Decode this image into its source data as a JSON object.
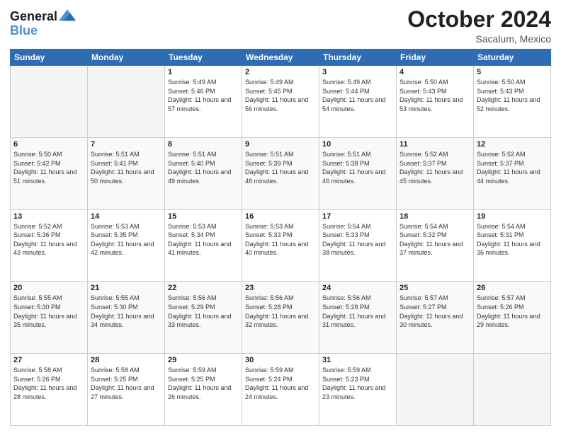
{
  "header": {
    "logo_line1": "General",
    "logo_line2": "Blue",
    "month": "October 2024",
    "location": "Sacalum, Mexico"
  },
  "weekdays": [
    "Sunday",
    "Monday",
    "Tuesday",
    "Wednesday",
    "Thursday",
    "Friday",
    "Saturday"
  ],
  "weeks": [
    [
      {
        "day": "",
        "empty": true
      },
      {
        "day": "",
        "empty": true
      },
      {
        "day": "1",
        "sunrise": "5:49 AM",
        "sunset": "5:46 PM",
        "daylight": "11 hours and 57 minutes."
      },
      {
        "day": "2",
        "sunrise": "5:49 AM",
        "sunset": "5:45 PM",
        "daylight": "11 hours and 56 minutes."
      },
      {
        "day": "3",
        "sunrise": "5:49 AM",
        "sunset": "5:44 PM",
        "daylight": "11 hours and 54 minutes."
      },
      {
        "day": "4",
        "sunrise": "5:50 AM",
        "sunset": "5:43 PM",
        "daylight": "11 hours and 53 minutes."
      },
      {
        "day": "5",
        "sunrise": "5:50 AM",
        "sunset": "5:43 PM",
        "daylight": "11 hours and 52 minutes."
      }
    ],
    [
      {
        "day": "6",
        "sunrise": "5:50 AM",
        "sunset": "5:42 PM",
        "daylight": "11 hours and 51 minutes."
      },
      {
        "day": "7",
        "sunrise": "5:51 AM",
        "sunset": "5:41 PM",
        "daylight": "11 hours and 50 minutes."
      },
      {
        "day": "8",
        "sunrise": "5:51 AM",
        "sunset": "5:40 PM",
        "daylight": "11 hours and 49 minutes."
      },
      {
        "day": "9",
        "sunrise": "5:51 AM",
        "sunset": "5:39 PM",
        "daylight": "11 hours and 48 minutes."
      },
      {
        "day": "10",
        "sunrise": "5:51 AM",
        "sunset": "5:38 PM",
        "daylight": "11 hours and 46 minutes."
      },
      {
        "day": "11",
        "sunrise": "5:52 AM",
        "sunset": "5:37 PM",
        "daylight": "11 hours and 45 minutes."
      },
      {
        "day": "12",
        "sunrise": "5:52 AM",
        "sunset": "5:37 PM",
        "daylight": "11 hours and 44 minutes."
      }
    ],
    [
      {
        "day": "13",
        "sunrise": "5:52 AM",
        "sunset": "5:36 PM",
        "daylight": "11 hours and 43 minutes."
      },
      {
        "day": "14",
        "sunrise": "5:53 AM",
        "sunset": "5:35 PM",
        "daylight": "11 hours and 42 minutes."
      },
      {
        "day": "15",
        "sunrise": "5:53 AM",
        "sunset": "5:34 PM",
        "daylight": "11 hours and 41 minutes."
      },
      {
        "day": "16",
        "sunrise": "5:53 AM",
        "sunset": "5:33 PM",
        "daylight": "11 hours and 40 minutes."
      },
      {
        "day": "17",
        "sunrise": "5:54 AM",
        "sunset": "5:33 PM",
        "daylight": "11 hours and 38 minutes."
      },
      {
        "day": "18",
        "sunrise": "5:54 AM",
        "sunset": "5:32 PM",
        "daylight": "11 hours and 37 minutes."
      },
      {
        "day": "19",
        "sunrise": "5:54 AM",
        "sunset": "5:31 PM",
        "daylight": "11 hours and 36 minutes."
      }
    ],
    [
      {
        "day": "20",
        "sunrise": "5:55 AM",
        "sunset": "5:30 PM",
        "daylight": "11 hours and 35 minutes."
      },
      {
        "day": "21",
        "sunrise": "5:55 AM",
        "sunset": "5:30 PM",
        "daylight": "11 hours and 34 minutes."
      },
      {
        "day": "22",
        "sunrise": "5:56 AM",
        "sunset": "5:29 PM",
        "daylight": "11 hours and 33 minutes."
      },
      {
        "day": "23",
        "sunrise": "5:56 AM",
        "sunset": "5:28 PM",
        "daylight": "11 hours and 32 minutes."
      },
      {
        "day": "24",
        "sunrise": "5:56 AM",
        "sunset": "5:28 PM",
        "daylight": "11 hours and 31 minutes."
      },
      {
        "day": "25",
        "sunrise": "5:57 AM",
        "sunset": "5:27 PM",
        "daylight": "11 hours and 30 minutes."
      },
      {
        "day": "26",
        "sunrise": "5:57 AM",
        "sunset": "5:26 PM",
        "daylight": "11 hours and 29 minutes."
      }
    ],
    [
      {
        "day": "27",
        "sunrise": "5:58 AM",
        "sunset": "5:26 PM",
        "daylight": "11 hours and 28 minutes."
      },
      {
        "day": "28",
        "sunrise": "5:58 AM",
        "sunset": "5:25 PM",
        "daylight": "11 hours and 27 minutes."
      },
      {
        "day": "29",
        "sunrise": "5:59 AM",
        "sunset": "5:25 PM",
        "daylight": "11 hours and 26 minutes."
      },
      {
        "day": "30",
        "sunrise": "5:59 AM",
        "sunset": "5:24 PM",
        "daylight": "11 hours and 24 minutes."
      },
      {
        "day": "31",
        "sunrise": "5:59 AM",
        "sunset": "5:23 PM",
        "daylight": "11 hours and 23 minutes."
      },
      {
        "day": "",
        "empty": true
      },
      {
        "day": "",
        "empty": true
      }
    ]
  ]
}
